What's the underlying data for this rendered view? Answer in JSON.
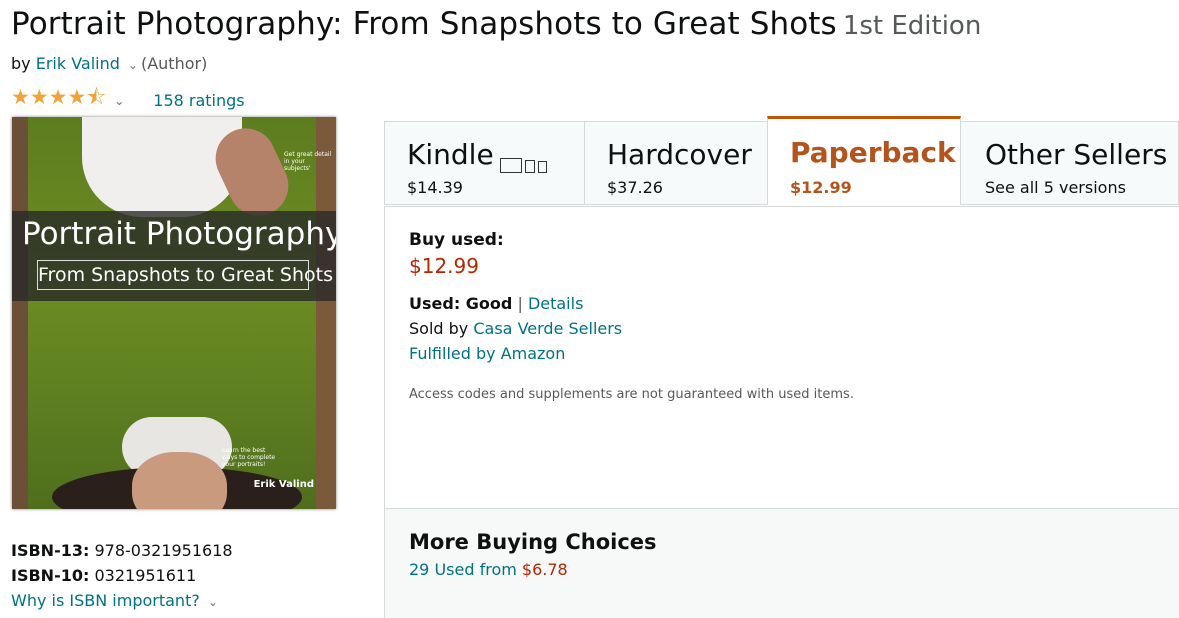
{
  "product": {
    "title": "Portrait Photography: From Snapshots to Great Shots",
    "edition": "1st Edition",
    "by": "by",
    "author": "Erik Valind",
    "author_role": "(Author)",
    "rating_value": 4.5,
    "ratings_count": "158 ratings"
  },
  "cover": {
    "title": "Portrait Photography",
    "subtitle": "From Snapshots to Great Shots",
    "author": "Erik Valind",
    "tip_top": "Get great detail in your subjects'",
    "tip_bottom": "Learn the best ways to complete your portraits!"
  },
  "formats": [
    {
      "name": "Kindle",
      "price": "$14.39"
    },
    {
      "name": "Hardcover",
      "price": "$37.26"
    },
    {
      "name": "Paperback",
      "price": "$12.99"
    },
    {
      "name": "Other Sellers",
      "price": "See all 5 versions"
    }
  ],
  "buy_box": {
    "heading": "Buy used:",
    "price": "$12.99",
    "condition_label": "Used: Good",
    "separator": "|",
    "details_link": "Details",
    "sold_by_prefix": "Sold by",
    "seller": "Casa Verde Sellers",
    "fulfilled": "Fulfilled by Amazon",
    "note": "Access codes and supplements are not guaranteed with used items."
  },
  "more_buying": {
    "heading": "More Buying Choices",
    "used_link": "29 Used from",
    "from_price": "$6.78"
  },
  "isbn": {
    "isbn13_label": "ISBN-13:",
    "isbn13": "978-0321951618",
    "isbn10_label": "ISBN-10:",
    "isbn10": "0321951611",
    "why_link": "Why is ISBN important?"
  },
  "colors": {
    "link": "#007185",
    "price": "#b12704",
    "active_tab": "#c45500",
    "star": "#f1a33a"
  }
}
